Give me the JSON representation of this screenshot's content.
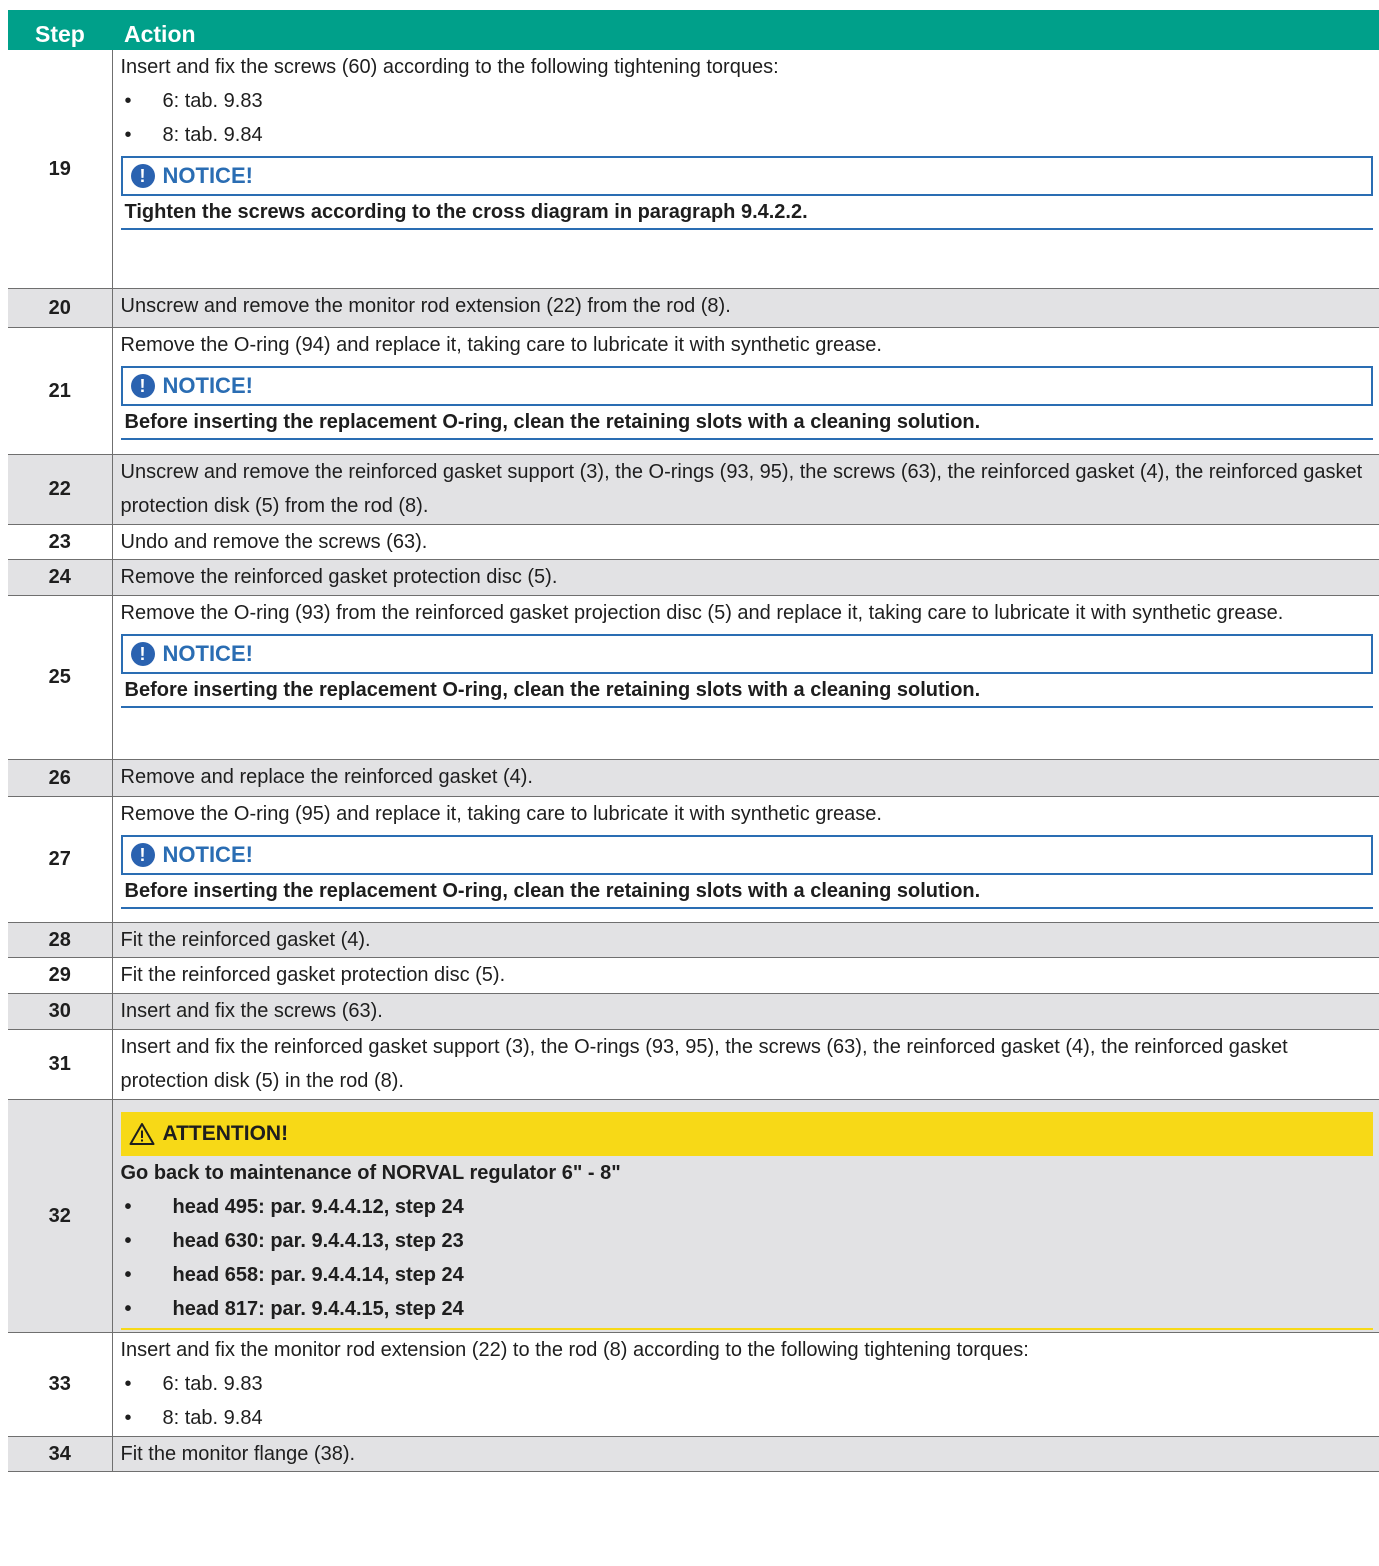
{
  "header": {
    "step": "Step",
    "action": "Action"
  },
  "rows": [
    {
      "step": "19",
      "text": "Insert and fix the screws (60) according to the following tightening torques:",
      "bullets": [
        "6: tab. 9.83",
        "8: tab. 9.84"
      ],
      "notice_title": "NOTICE!",
      "notice_text": "Tighten the screws according to the cross diagram in paragraph 9.4.2.2."
    },
    {
      "step": "20",
      "text": "Unscrew and remove the monitor rod extension (22) from the rod (8)."
    },
    {
      "step": "21",
      "text": "Remove the O-ring (94) and replace it, taking care to lubricate it with synthetic grease.",
      "notice_title": "NOTICE!",
      "notice_text": "Before inserting the replacement O-ring, clean the retaining slots with a cleaning solution."
    },
    {
      "step": "22",
      "text": "Unscrew and remove the reinforced gasket support (3), the O-rings (93, 95), the screws (63), the reinforced gasket (4), the reinforced gasket protection disk (5) from the rod (8)."
    },
    {
      "step": "23",
      "text": "Undo and remove the screws (63)."
    },
    {
      "step": "24",
      "text": "Remove the reinforced gasket protection disc (5)."
    },
    {
      "step": "25",
      "text": "Remove the O-ring (93) from the reinforced gasket projection disc (5) and replace it, taking care to lubricate it with synthetic grease.",
      "notice_title": "NOTICE!",
      "notice_text": "Before inserting the replacement O-ring, clean the retaining slots with a cleaning solution."
    },
    {
      "step": "26",
      "text": "Remove and replace the reinforced gasket (4)."
    },
    {
      "step": "27",
      "text": "Remove the O-ring (95) and replace it, taking care to lubricate it with synthetic grease.",
      "notice_title": "NOTICE!",
      "notice_text": "Before inserting the replacement O-ring, clean the retaining slots with a cleaning solution."
    },
    {
      "step": "28",
      "text": "Fit the reinforced gasket (4)."
    },
    {
      "step": "29",
      "text": "Fit the reinforced gasket protection disc (5)."
    },
    {
      "step": "30",
      "text": "Insert and fix the screws (63)."
    },
    {
      "step": "31",
      "text": "Insert and fix the reinforced gasket support (3), the O-rings (93, 95), the screws (63), the reinforced gasket (4), the reinforced gasket protection disk (5) in the rod (8)."
    },
    {
      "step": "32",
      "attention_title": "ATTENTION!",
      "attention_text": "Go back to maintenance of NORVAL regulator 6\" - 8\"",
      "attention_bullets": [
        "head 495: par. 9.4.4.12, step 24",
        "head 630: par. 9.4.4.13, step 23",
        "head 658: par. 9.4.4.14, step 24",
        "head 817: par. 9.4.4.15, step 24"
      ]
    },
    {
      "step": "33",
      "text": "Insert and fix the monitor rod extension (22) to the rod (8) according to the following tightening torques:",
      "bullets": [
        "6: tab. 9.83",
        "8: tab. 9.84"
      ]
    },
    {
      "step": "34",
      "text": "Fit the monitor flange (38)."
    }
  ],
  "colors": {
    "header_bg": "#00a08a",
    "row_gray": "#e2e2e4",
    "notice_blue": "#2a6db3",
    "attention_yellow": "#f7d917"
  },
  "icons": {
    "notice": "exclamation-circle-icon",
    "attention": "warning-triangle-icon"
  }
}
